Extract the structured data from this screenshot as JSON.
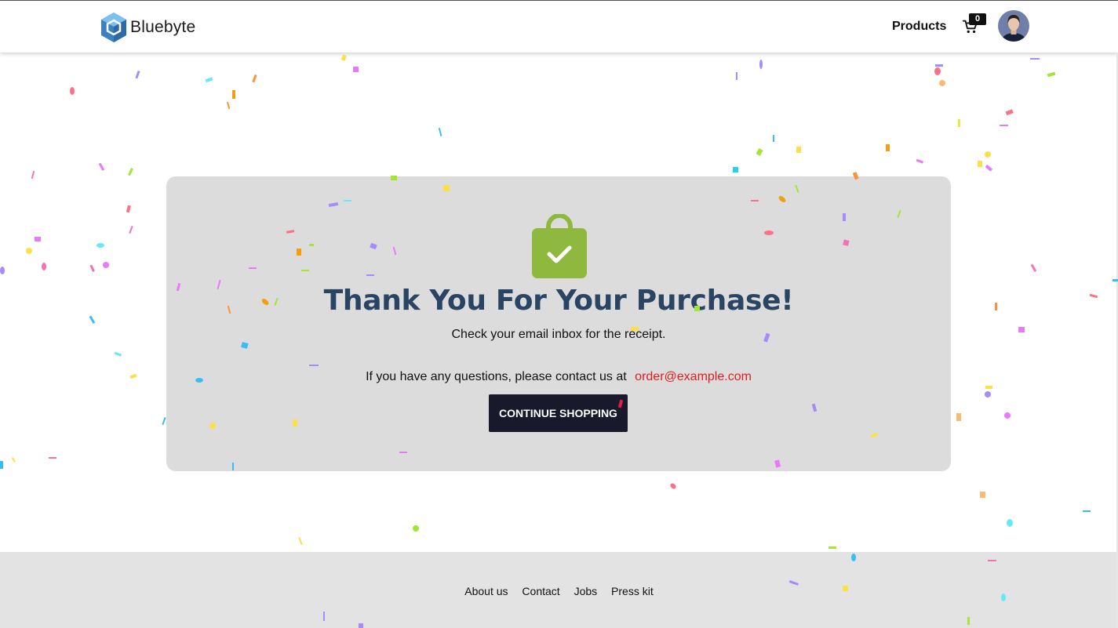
{
  "header": {
    "logo_text": "Bluebyte",
    "nav_products": "Products",
    "cart_count": "0",
    "icons": {
      "logo": "hexagon-cube-logo",
      "cart": "cart-icon",
      "avatar": "user-avatar"
    }
  },
  "main": {
    "icon": "shopping-bag-check-icon",
    "title": "Thank You For Your Purchase!",
    "subtitle": "Check your email inbox for the receipt.",
    "contact_text": "If you have any questions, please contact us at",
    "contact_email": "order@example.com",
    "continue_button": "CONTINUE SHOPPING"
  },
  "footer": {
    "links": [
      "About us",
      "Contact",
      "Jobs",
      "Press kit"
    ]
  },
  "colors": {
    "title": "#2a4563",
    "accent_link": "#e01e1e",
    "button_bg": "#181a2b",
    "card_bg": "#dcdcdc",
    "bag_green": "#8fb83e",
    "logo_blue": "#3b82c4"
  }
}
